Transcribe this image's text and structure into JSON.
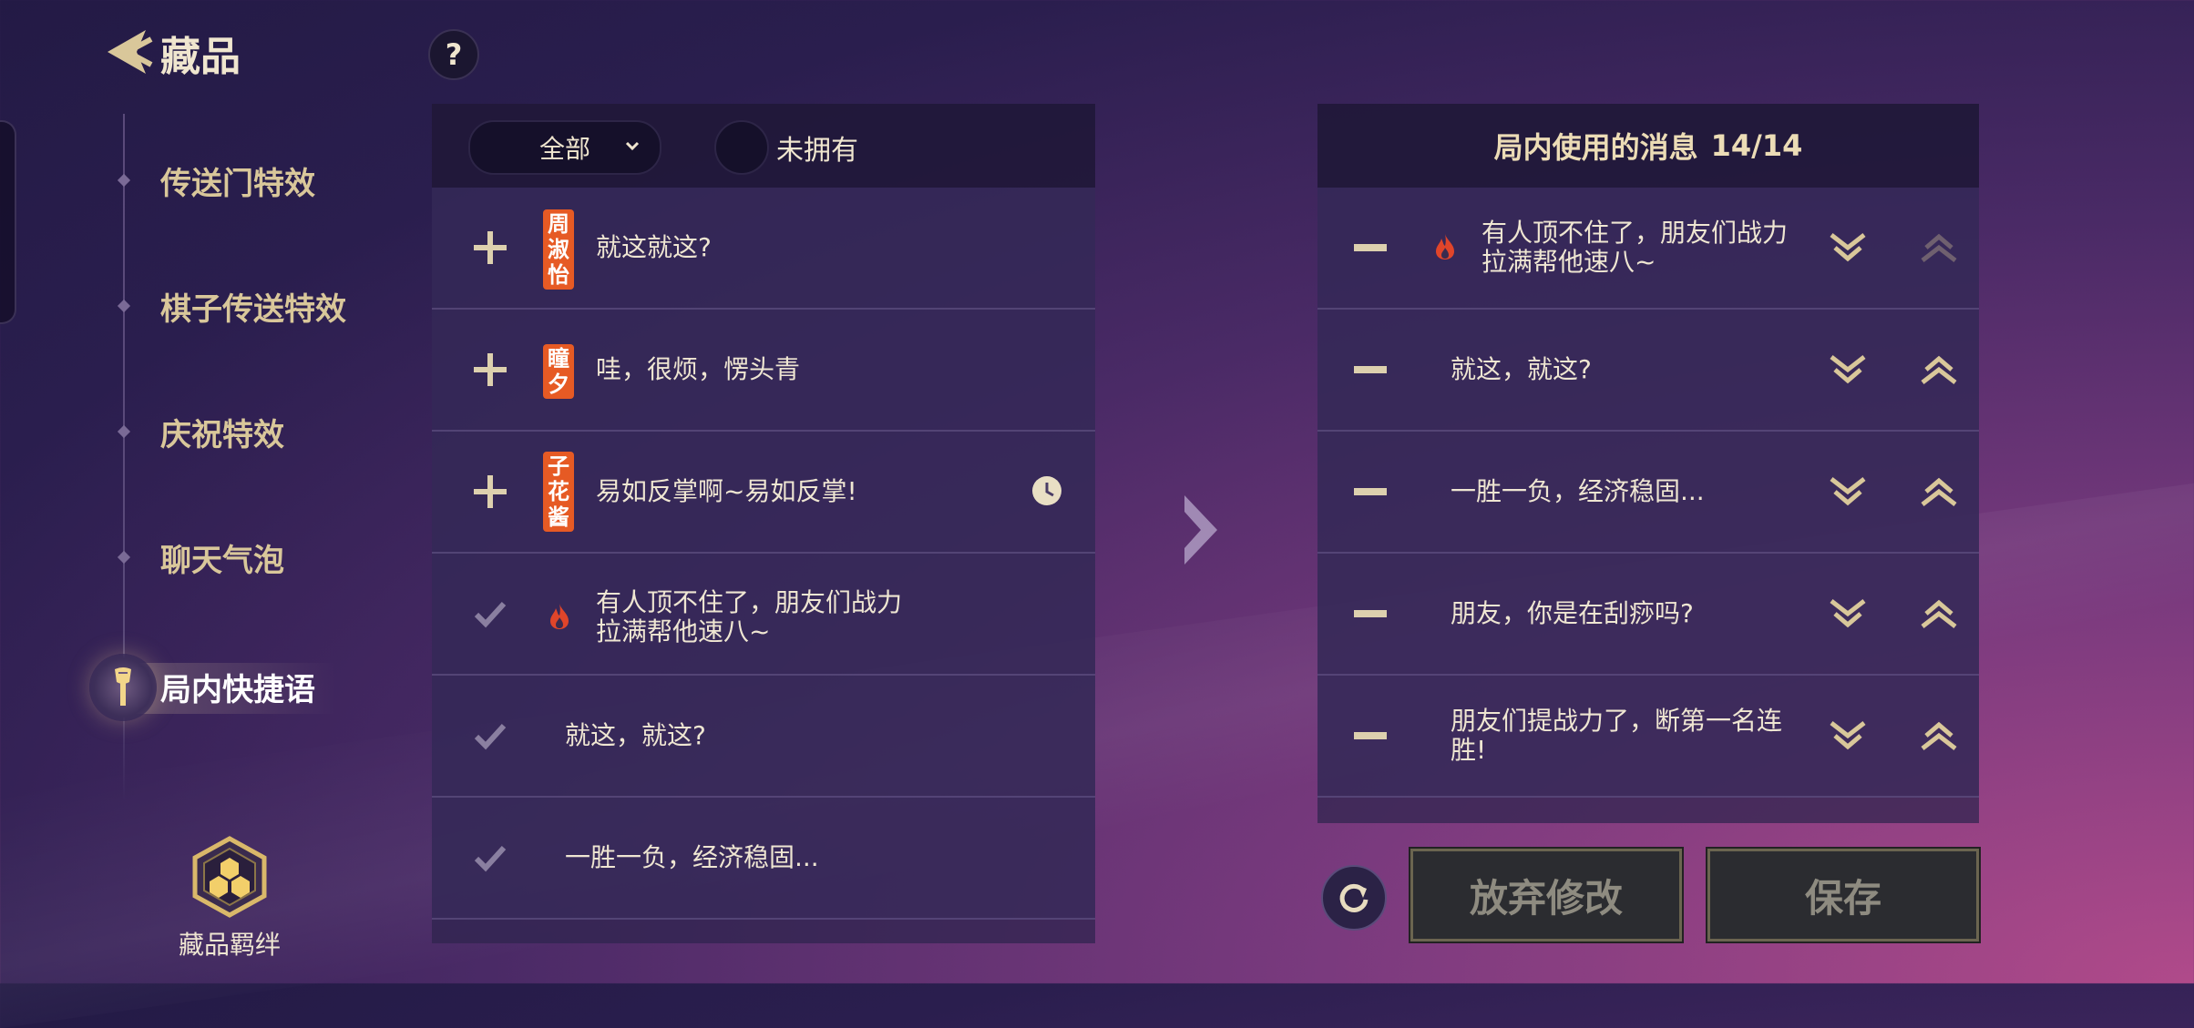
{
  "header": {
    "title": "藏品",
    "help": "?"
  },
  "sidebar": {
    "items": [
      {
        "label": "传送门特效"
      },
      {
        "label": "棋子传送特效"
      },
      {
        "label": "庆祝特效"
      },
      {
        "label": "聊天气泡"
      },
      {
        "label": "局内快捷语"
      }
    ],
    "bond_label": "藏品羁绊"
  },
  "filters": {
    "dropdown_value": "全部",
    "toggle_label": "未拥有"
  },
  "library": {
    "rows": [
      {
        "state": "add",
        "tag": "周淑怡",
        "text": "就这就这?",
        "timer": false
      },
      {
        "state": "add",
        "tag": "瞳夕",
        "text": "哇，很烦，愣头青",
        "timer": false
      },
      {
        "state": "add",
        "tag": "子花酱",
        "text": "易如反掌啊~易如反掌!",
        "timer": true
      },
      {
        "state": "owned",
        "icon": "fire-icon",
        "text": "有人顶不住了，朋友们战力拉满帮他速八~"
      },
      {
        "state": "owned",
        "text": "就这，就这?"
      },
      {
        "state": "owned",
        "text": "一胜一负，经济稳固..."
      }
    ]
  },
  "equipped": {
    "title": "局内使用的消息",
    "count": "14/14",
    "rows": [
      {
        "icon": "fire-icon",
        "text": "有人顶不住了，朋友们战力拉满帮他速八~"
      },
      {
        "text": "就这，就这?"
      },
      {
        "text": "一胜一负，经济稳固..."
      },
      {
        "text": "朋友，你是在刮痧吗?"
      },
      {
        "text": "朋友们提战力了，断第一名连胜!"
      }
    ]
  },
  "buttons": {
    "discard": "放弃修改",
    "save": "保存"
  },
  "colors": {
    "tag": "#e65a24",
    "gold": "#d9c79a",
    "fire": "#e0452a"
  }
}
